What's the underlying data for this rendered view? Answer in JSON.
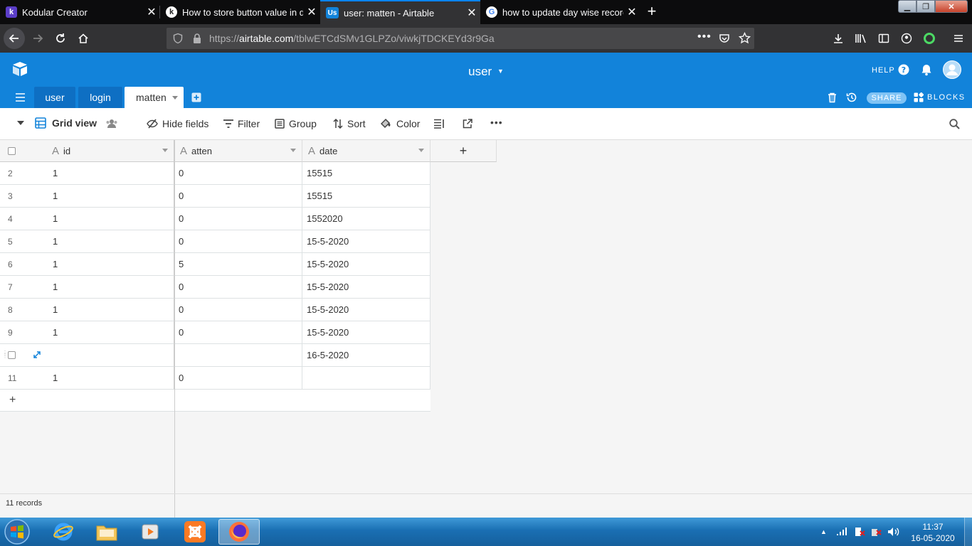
{
  "browser": {
    "tabs": [
      {
        "title": "Kodular Creator",
        "favicon": "k"
      },
      {
        "title": "How to store button value in d",
        "favicon": "k"
      },
      {
        "title": "user: matten - Airtable",
        "favicon": "Us"
      },
      {
        "title": "how to update day wise record",
        "favicon": "G"
      }
    ],
    "url_prefix": "https://",
    "url_domain": "airtable.com",
    "url_path": "/tblwETCdSMv1GLPZo/viwkjTDCKEYd3r9Ga"
  },
  "airtable": {
    "base_name": "user",
    "help_label": "HELP",
    "share_label": "SHARE",
    "blocks_label": "BLOCKS",
    "tables": [
      "user",
      "login",
      "matten"
    ]
  },
  "viewbar": {
    "view_name": "Grid view",
    "hide_fields": "Hide fields",
    "filter": "Filter",
    "group": "Group",
    "sort": "Sort",
    "color": "Color"
  },
  "grid": {
    "columns": [
      "id",
      "atten",
      "date"
    ],
    "rows": [
      {
        "num": "2",
        "id": "1",
        "atten": "0",
        "date": "15515"
      },
      {
        "num": "3",
        "id": "1",
        "atten": "0",
        "date": "15515"
      },
      {
        "num": "4",
        "id": "1",
        "atten": "0",
        "date": "1552020"
      },
      {
        "num": "5",
        "id": "1",
        "atten": "0",
        "date": "15-5-2020"
      },
      {
        "num": "6",
        "id": "1",
        "atten": "5",
        "date": "15-5-2020"
      },
      {
        "num": "7",
        "id": "1",
        "atten": "0",
        "date": "15-5-2020"
      },
      {
        "num": "8",
        "id": "1",
        "atten": "0",
        "date": "15-5-2020"
      },
      {
        "num": "9",
        "id": "1",
        "atten": "0",
        "date": "15-5-2020"
      },
      {
        "num": "",
        "id": "",
        "atten": "",
        "date": "16-5-2020"
      },
      {
        "num": "11",
        "id": "1",
        "atten": "0",
        "date": ""
      }
    ],
    "add_row_label": "+",
    "add_column_label": "+"
  },
  "footer": {
    "record_count": "11 records"
  },
  "taskbar": {
    "time": "11:37",
    "date": "16-05-2020"
  },
  "colors": {
    "airtable_blue": "#1283da",
    "browser_dark": "#0c0c0d",
    "taskbar_blue": "#1a6fb3"
  }
}
